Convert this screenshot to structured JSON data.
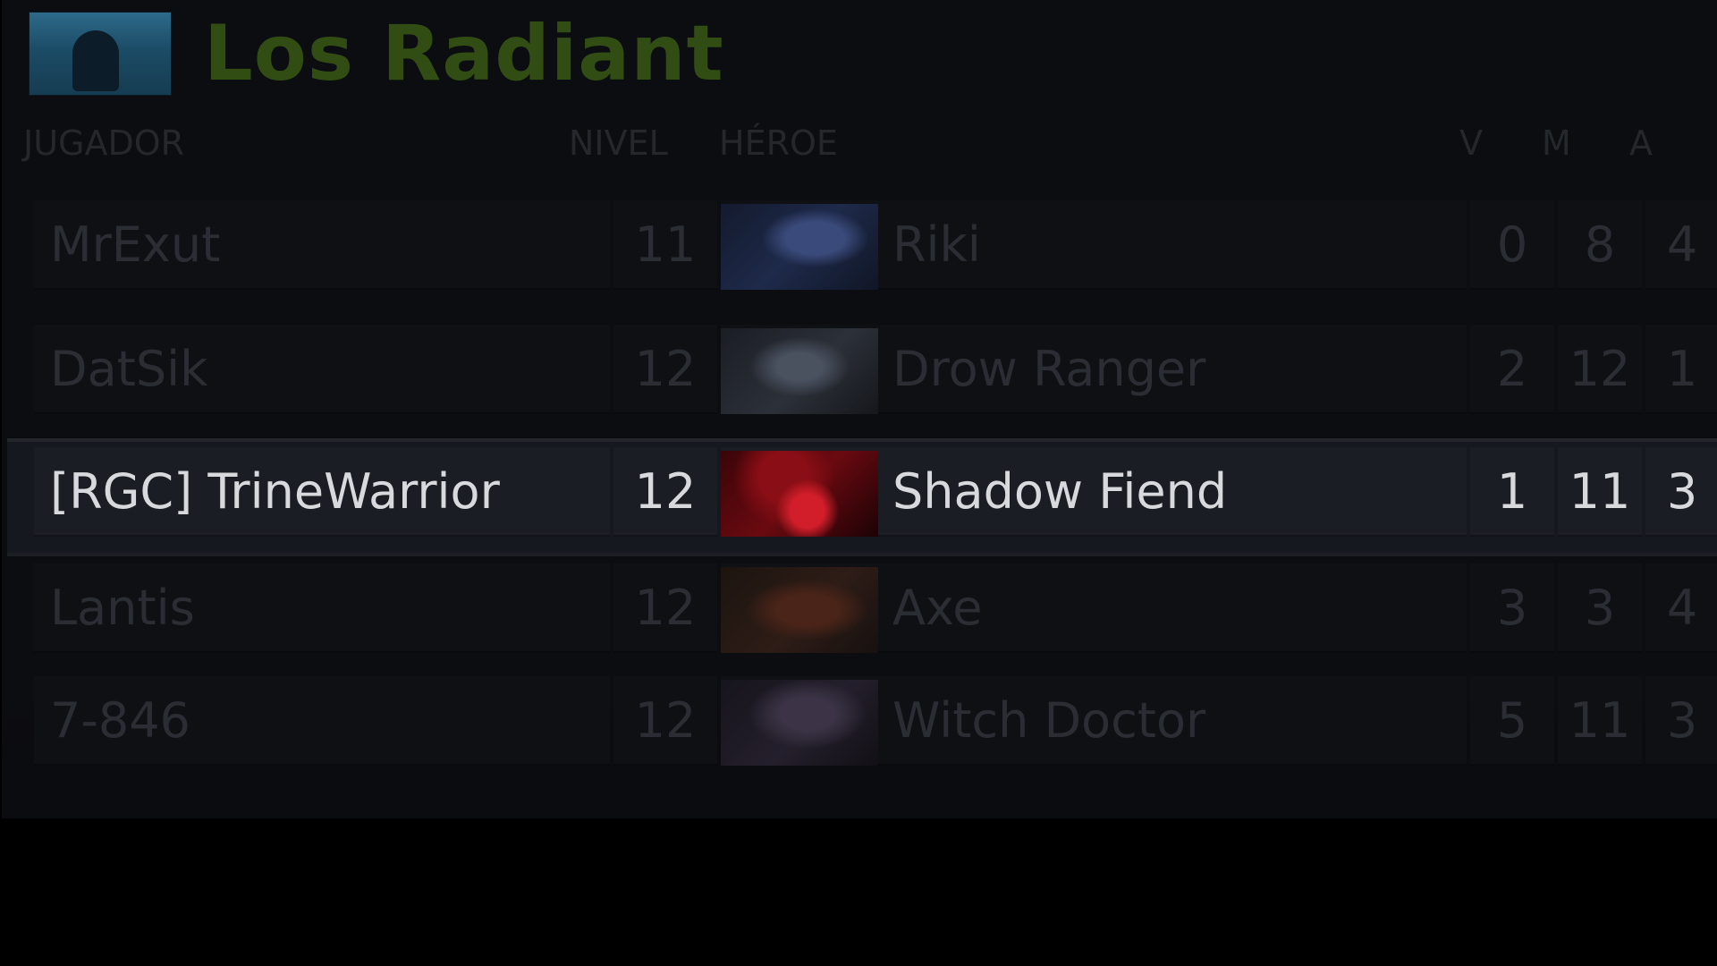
{
  "team": {
    "name": "Los Radiant",
    "name_color": "#314d14",
    "logo_icon": "team-logo-icon"
  },
  "columns": {
    "player": "JUGADOR",
    "level": "NIVEL",
    "hero": "HÉROE",
    "kills": "V",
    "deaths": "M",
    "assists": "A"
  },
  "rows": [
    {
      "player": "MrExut",
      "level": "11",
      "hero": "Riki",
      "hero_icon": "riki-portrait-icon",
      "kills": "0",
      "deaths": "8",
      "assists": "4",
      "selected": false
    },
    {
      "player": "DatSik",
      "level": "12",
      "hero": "Drow Ranger",
      "hero_icon": "drow-ranger-portrait-icon",
      "kills": "2",
      "deaths": "12",
      "assists": "1",
      "selected": false
    },
    {
      "player": "[RGC] TrineWarrior",
      "level": "12",
      "hero": "Shadow Fiend",
      "hero_icon": "shadow-fiend-portrait-icon",
      "kills": "1",
      "deaths": "11",
      "assists": "3",
      "selected": true
    },
    {
      "player": "Lantis",
      "level": "12",
      "hero": "Axe",
      "hero_icon": "axe-portrait-icon",
      "kills": "3",
      "deaths": "3",
      "assists": "4",
      "selected": false
    },
    {
      "player": "7-846",
      "level": "12",
      "hero": "Witch Doctor",
      "hero_icon": "witch-doctor-portrait-icon",
      "kills": "5",
      "deaths": "11",
      "assists": "3",
      "selected": false
    }
  ],
  "colors": {
    "dim_text": "#2a2d33",
    "selected_text": "#d8d9dc",
    "row_bg": "#0e1014",
    "selected_row_bg": "#1a1d24"
  }
}
